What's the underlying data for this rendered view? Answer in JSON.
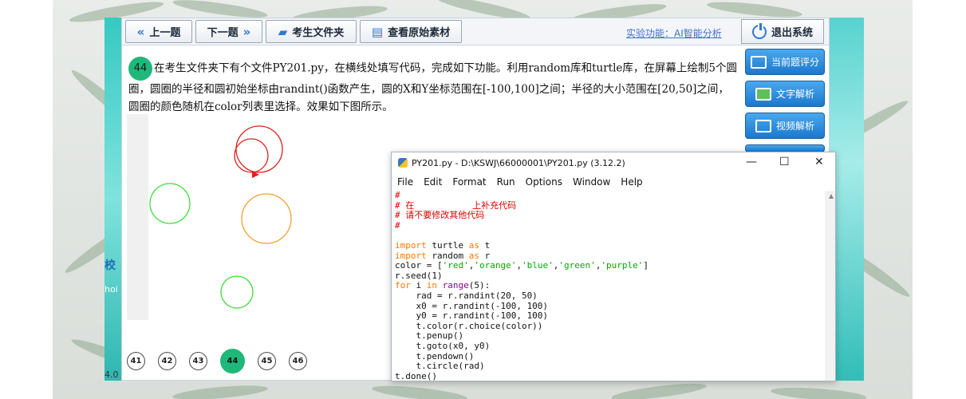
{
  "toolbar": {
    "prev_label": "上一题",
    "next_label": "下一题",
    "folder_label": "考生文件夹",
    "source_label": "查看原始素材",
    "ai_link": "实验功能：AI智能分析",
    "exit_label": "退出系统"
  },
  "question": {
    "number": "44",
    "text": "在考生文件夹下有个文件PY201.py，在横线处填写代码，完成如下功能。利用random库和turtle库，在屏幕上绘制5个圆圈，圆圈的半径和圆初始坐标由randint()函数产生，圆的X和Y坐标范围在[-100,100]之间；半径的大小范围在[20,50]之间，圆圈的颜色随机在color列表里选择。效果如下图所示。"
  },
  "sidebar": {
    "score_label": "当前题评分",
    "text_analysis_label": "文字解析",
    "video_analysis_label": "视频解析"
  },
  "pager": [
    "41",
    "42",
    "43",
    "44",
    "45",
    "46"
  ],
  "pager_active": "44",
  "idle": {
    "title": "PY201.py - D:\\KSWJ\\66000001\\PY201.py (3.12.2)",
    "menu": [
      "File",
      "Edit",
      "Format",
      "Run",
      "Options",
      "Window",
      "Help"
    ],
    "code_lines": [
      "#",
      "# 在           上补充代码",
      "# 请不要修改其他代码",
      "#",
      "",
      "import turtle as t",
      "import random as r",
      "color = ['red','orange','blue','green','purple']",
      "r.seed(1)",
      "for i in range(5):",
      "    rad = r.randint(20, 50)",
      "    x0 = r.randint(-100, 100)",
      "    y0 = r.randint(-100, 100)",
      "    t.color(r.choice(color))",
      "    t.penup()",
      "    t.goto(x0, y0)",
      "    t.pendown()",
      "    t.circle(rad)",
      "t.done()"
    ]
  },
  "figure": {
    "circles": [
      {
        "color": "#e02020"
      },
      {
        "color": "#e02020"
      },
      {
        "color": "#3cdc3c"
      },
      {
        "color": "#f0a030"
      },
      {
        "color": "#3cdc3c"
      }
    ]
  },
  "colors": {
    "accent_green": "#1fb87a",
    "side_button_blue": "#1b78cf",
    "link_blue": "#3d72c9"
  },
  "desktop": {
    "label_a": "校",
    "label_b": "hoi",
    "label_c": "4.0"
  }
}
